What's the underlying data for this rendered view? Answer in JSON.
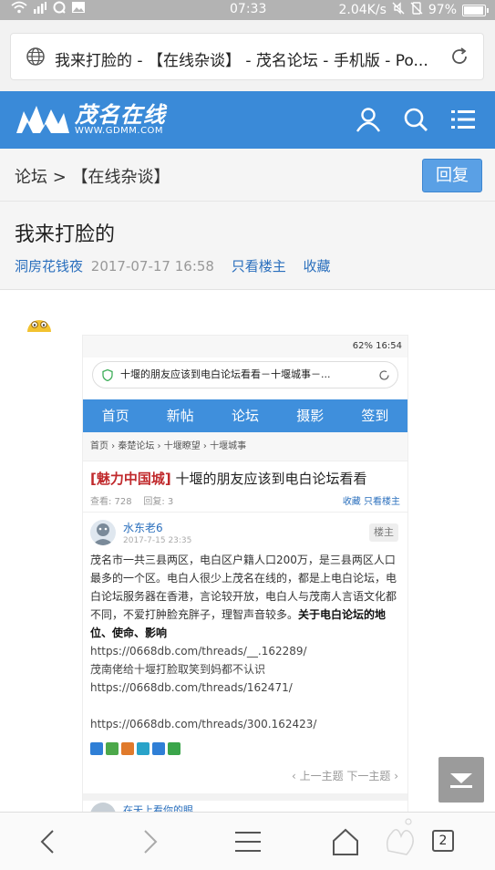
{
  "status_bar": {
    "time": "07:33",
    "net_speed": "2.04K/s",
    "battery": "97%",
    "battery_level": 0.97
  },
  "browser": {
    "page_title": "我来打脸的 - 【在线杂谈】 - 茂名论坛 - 手机版 - Po..."
  },
  "site": {
    "logo_cn": "茂名在线",
    "logo_en": "WWW.GDMM.COM",
    "brand_color": "#3a8ad8"
  },
  "breadcrumb": "论坛 > 【在线杂谈】",
  "reply_label": "回复",
  "thread": {
    "title": "我来打脸的",
    "author": "洞房花钱夜",
    "date": "2017-07-17 16:58",
    "only_op": "只看楼主",
    "favorite": "收藏"
  },
  "embedded": {
    "status": "62% 16:54",
    "url_title": "十堰的朋友应该到电白论坛看看－十堰城事－...",
    "nav": [
      "首页",
      "新帖",
      "论坛",
      "摄影",
      "签到"
    ],
    "crumb": "首页  ›  秦楚论坛  ›  十堰瞭望  ›  十堰城事",
    "tag": "[魅力中国城]",
    "title": " 十堰的朋友应该到电白论坛看看",
    "views": "查看: 728",
    "replies": "回复: 3",
    "stats_links": "收藏  只看楼主",
    "poster_name": "水东老6",
    "poster_time": "2017-7-15 23:35",
    "op_badge": "楼主",
    "body": "茂名市一共三县两区，电白区户籍人口200万，是三县两区人口最多的一个区。电白人很少上茂名在线的，都是上电白论坛，电白论坛服务器在香港，言论较开放，电白人与茂南人言语文化都不同，不爱打肿脸充胖子，理智声音较多。",
    "body_bold": "关于电白论坛的地位、使命、影响",
    "link1": "https://0668db.com/threads/__.162289/",
    "line_mid": "茂南佬给十堰打脸取笑到妈都不认识",
    "link2": "https://0668db.com/threads/162471/",
    "link3": "https://0668db.com/threads/300.162423/",
    "pager": "‹ 上一主题   下一主题 ›",
    "next_name": "在天上看你的眼"
  },
  "bottom_nav": {
    "tab_count": "2"
  }
}
